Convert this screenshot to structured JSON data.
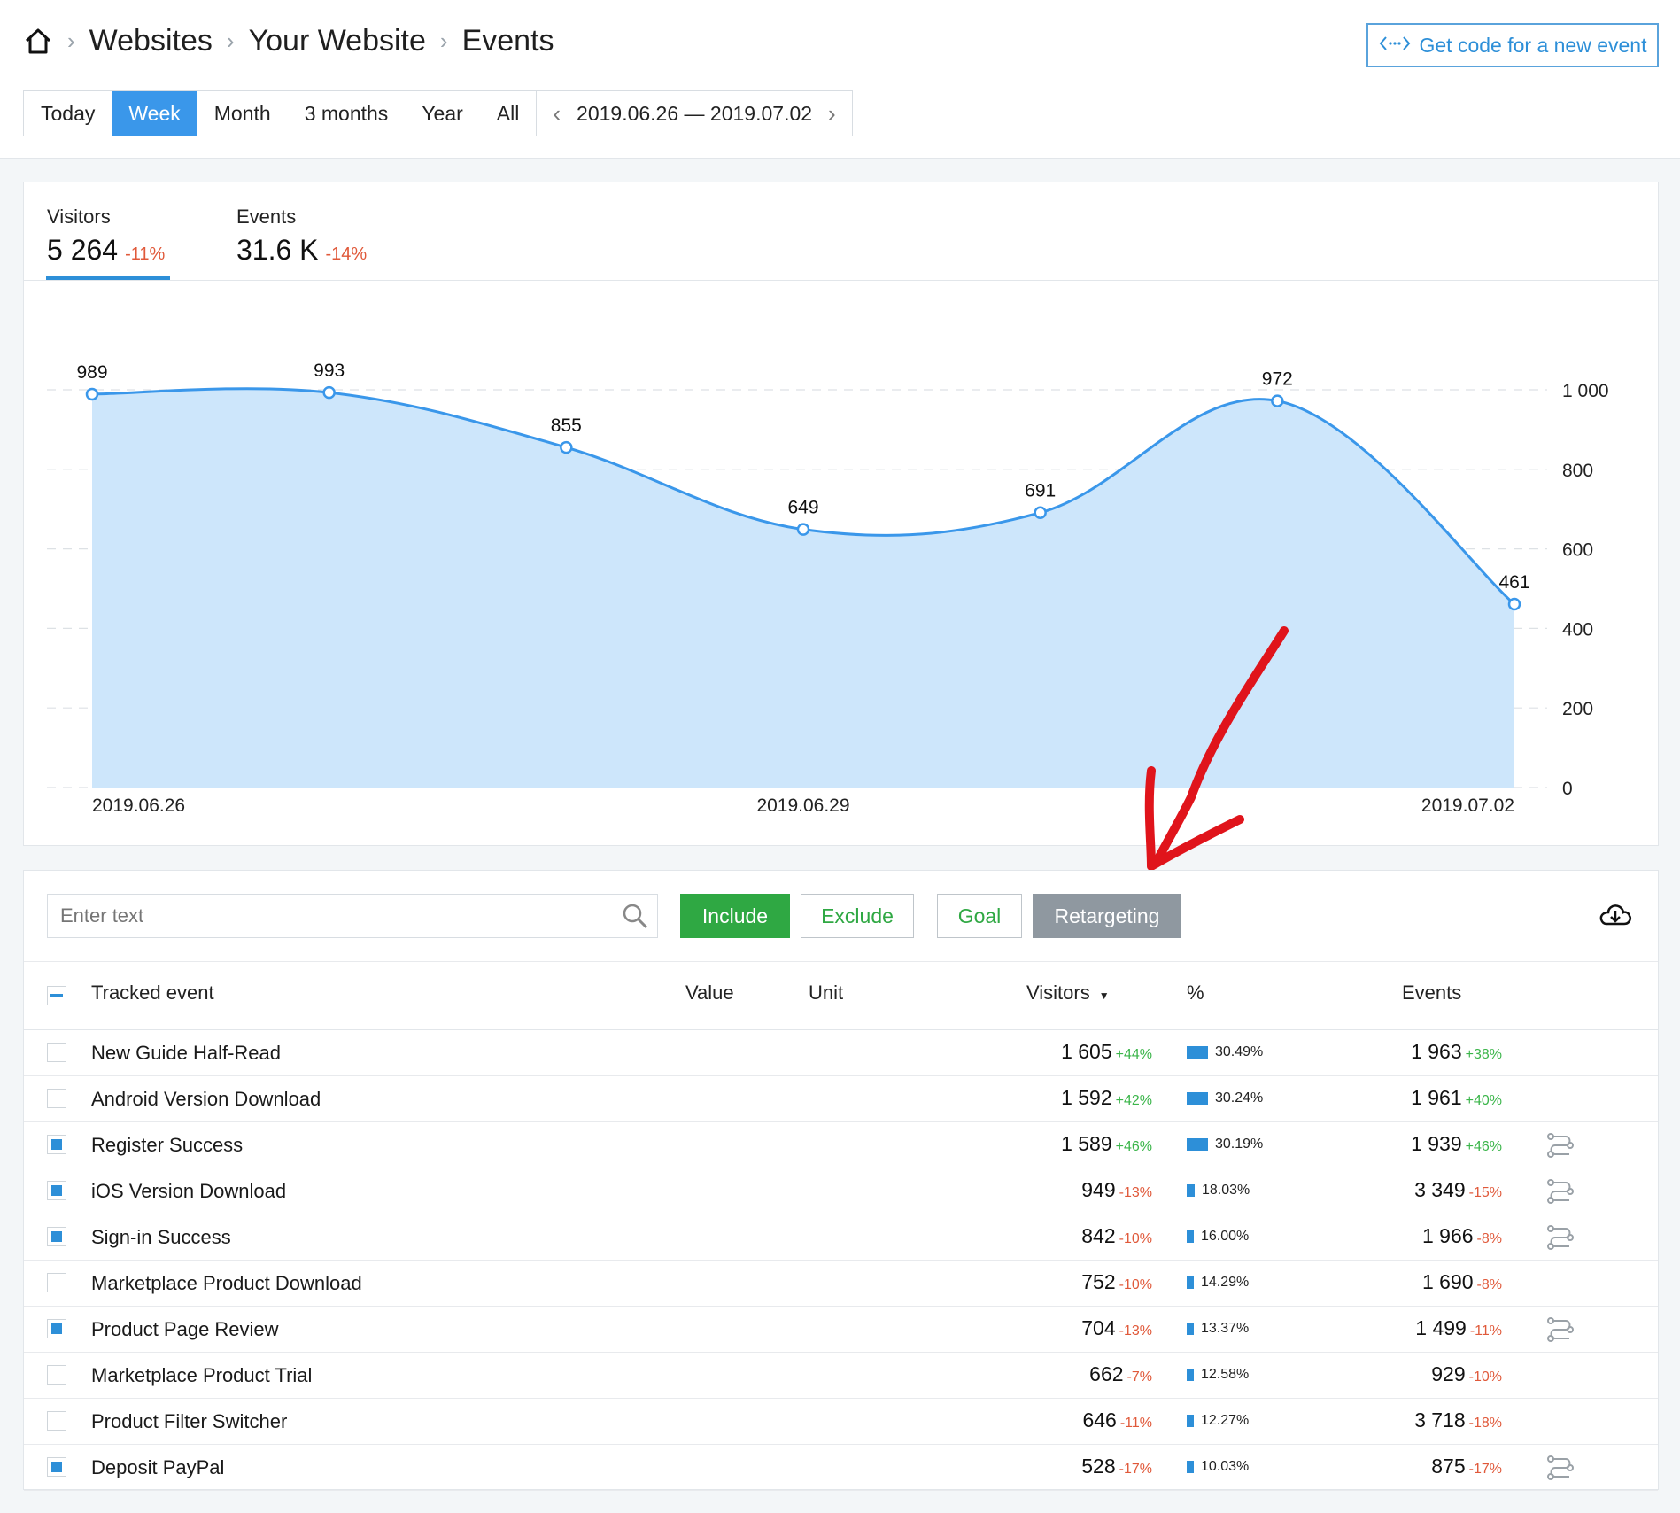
{
  "header": {
    "breadcrumb": [
      "Websites",
      "Your Website",
      "Events"
    ],
    "get_code_label": "Get code for a new event",
    "periods": [
      "Today",
      "Week",
      "Month",
      "3 months",
      "Year",
      "All"
    ],
    "active_period": "Week",
    "date_range": "2019.06.26 — 2019.07.02"
  },
  "metrics": {
    "visitors": {
      "label": "Visitors",
      "value": "5 264",
      "delta": "-11%"
    },
    "events": {
      "label": "Events",
      "value": "31.6 K",
      "delta": "-14%"
    }
  },
  "chart_data": {
    "type": "area",
    "x": [
      "2019.06.26",
      "2019.06.27",
      "2019.06.28",
      "2019.06.29",
      "2019.06.30",
      "2019.07.01",
      "2019.07.02"
    ],
    "series": [
      {
        "values": [
          989,
          993,
          855,
          649,
          691,
          972,
          461
        ]
      }
    ],
    "x_tick_labels": [
      "2019.06.26",
      "2019.06.29",
      "2019.07.02"
    ],
    "y_ticks": [
      "0",
      "200",
      "400",
      "600",
      "800",
      "1 000"
    ],
    "ylim": [
      0,
      1000
    ],
    "grid": true,
    "colors": {
      "line": "#3a97ea",
      "fill": "#cde6fb"
    }
  },
  "filters": {
    "search_placeholder": "Enter text",
    "include": "Include",
    "exclude": "Exclude",
    "goal": "Goal",
    "retargeting": "Retargeting"
  },
  "table": {
    "headers": {
      "event": "Tracked event",
      "value": "Value",
      "unit": "Unit",
      "visitors": "Visitors",
      "pct": "%",
      "events": "Events"
    },
    "rows": [
      {
        "name": "New Guide Half-Read",
        "visitors": "1 605",
        "vdelta": "+44%",
        "pct": "30.49%",
        "events": "1 963",
        "edelta": "+38%",
        "checked": false,
        "flow": false
      },
      {
        "name": "Android Version Download",
        "visitors": "1 592",
        "vdelta": "+42%",
        "pct": "30.24%",
        "events": "1 961",
        "edelta": "+40%",
        "checked": false,
        "flow": false
      },
      {
        "name": "Register Success",
        "visitors": "1 589",
        "vdelta": "+46%",
        "pct": "30.19%",
        "events": "1 939",
        "edelta": "+46%",
        "checked": true,
        "flow": true
      },
      {
        "name": "iOS Version Download",
        "visitors": "949",
        "vdelta": "-13%",
        "pct": "18.03%",
        "events": "3 349",
        "edelta": "-15%",
        "checked": true,
        "flow": true
      },
      {
        "name": "Sign-in Success",
        "visitors": "842",
        "vdelta": "-10%",
        "pct": "16.00%",
        "events": "1 966",
        "edelta": "-8%",
        "checked": true,
        "flow": true
      },
      {
        "name": "Marketplace Product Download",
        "visitors": "752",
        "vdelta": "-10%",
        "pct": "14.29%",
        "events": "1 690",
        "edelta": "-8%",
        "checked": false,
        "flow": false
      },
      {
        "name": "Product Page Review",
        "visitors": "704",
        "vdelta": "-13%",
        "pct": "13.37%",
        "events": "1 499",
        "edelta": "-11%",
        "checked": true,
        "flow": true
      },
      {
        "name": "Marketplace Product Trial",
        "visitors": "662",
        "vdelta": "-7%",
        "pct": "12.58%",
        "events": "929",
        "edelta": "-10%",
        "checked": false,
        "flow": false
      },
      {
        "name": "Product Filter Switcher",
        "visitors": "646",
        "vdelta": "-11%",
        "pct": "12.27%",
        "events": "3 718",
        "edelta": "-18%",
        "checked": false,
        "flow": false
      },
      {
        "name": "Deposit PayPal",
        "visitors": "528",
        "vdelta": "-17%",
        "pct": "10.03%",
        "events": "875",
        "edelta": "-17%",
        "checked": true,
        "flow": true
      }
    ]
  },
  "colors": {
    "accent": "#2d8fd8",
    "positive": "#3bb54a",
    "negative": "#e0593a",
    "include": "#2fa843",
    "annotation_arrow": "#e0141b"
  }
}
